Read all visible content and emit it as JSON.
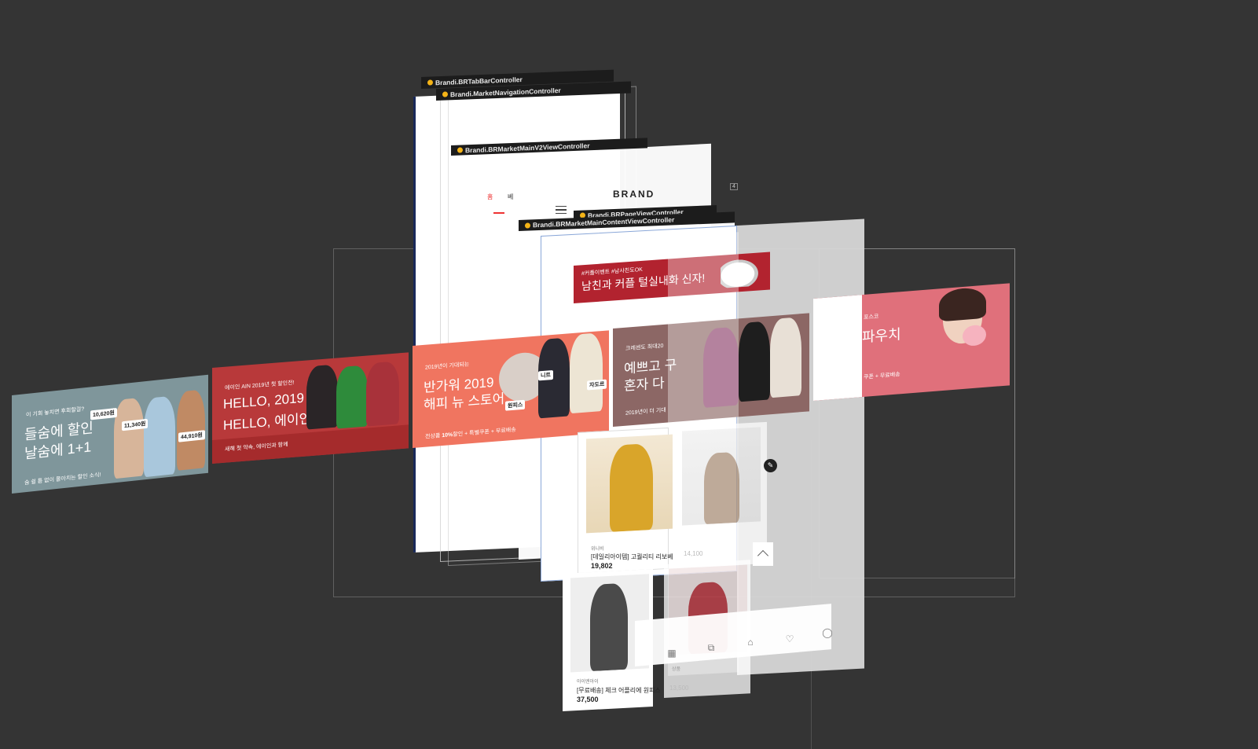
{
  "view_controllers": {
    "tab_bar": "Brandi.BRTabBarController",
    "market_nav": "Brandi.MarketNavigationController",
    "main_v2": "Brandi.BRMarketMainV2ViewController",
    "page_view": "Brandi.BRPageViewController",
    "main_content": "Brandi.BRMarketMainContentViewController"
  },
  "header": {
    "logo": "BRAND",
    "tab_home": "홈",
    "tab_best": "베",
    "badge_count": "4"
  },
  "banners": [
    {
      "line1": "이 기회 놓치면 후회할걸?",
      "line2": "들숨에 할인",
      "line3": "날숨에 1+1",
      "footer": "숨 쉴 틈 없이 몰아치는 할인 소식!",
      "prices": [
        "10,620원",
        "11,340원",
        "44,910원"
      ],
      "color": "#7f969b"
    },
    {
      "line1": "에이인 AIN 2019년 첫 할인전!",
      "line2": "HELLO, 2019",
      "line3": "HELLO, 에이인",
      "footer": "새해 첫 약속, 에이인과 함께",
      "color": "#b8393a"
    },
    {
      "line1": "2019년이 기대되는",
      "line2": "반가워 2019",
      "line3": "해피 뉴 스토어",
      "footer_pre": "전상품 ",
      "footer_bold": "10%",
      "footer_post": "할인 + 특별쿠폰 + 무료배송",
      "tags": [
        "원피스",
        "니트",
        "자도르"
      ],
      "color": "#f07560"
    },
    {
      "line1": "크레센도 최대20",
      "line2": "예쁘고 구",
      "line3": "혼자 다",
      "footer": "2019년이 더 기대",
      "color": "#8c6765"
    },
    {
      "line1": "포스코",
      "line2": "파우치",
      "footer": "쿠폰 + 무료배송",
      "color": "#e0707b"
    }
  ],
  "top_banner": {
    "hashtags": "#커플이벤트 #남사친도OK",
    "title": "남친과 커플 털실내화 신자!"
  },
  "products": [
    {
      "shop": "위니비",
      "name": "[데일리아이템] 고퀄리티 리보베",
      "price": "19,802"
    },
    {
      "shop": "",
      "name": "",
      "price": "14,100"
    },
    {
      "shop": "아이엔아이",
      "name": "[무료배송] 체크 어플리에 원피스",
      "price": "37,500"
    },
    {
      "shop": "",
      "name": "",
      "price": "13,500"
    }
  ],
  "tab_bar": {
    "items": [
      "카테고리",
      "스토어",
      "홈",
      "찜",
      "마이"
    ],
    "home_label": "상품"
  }
}
